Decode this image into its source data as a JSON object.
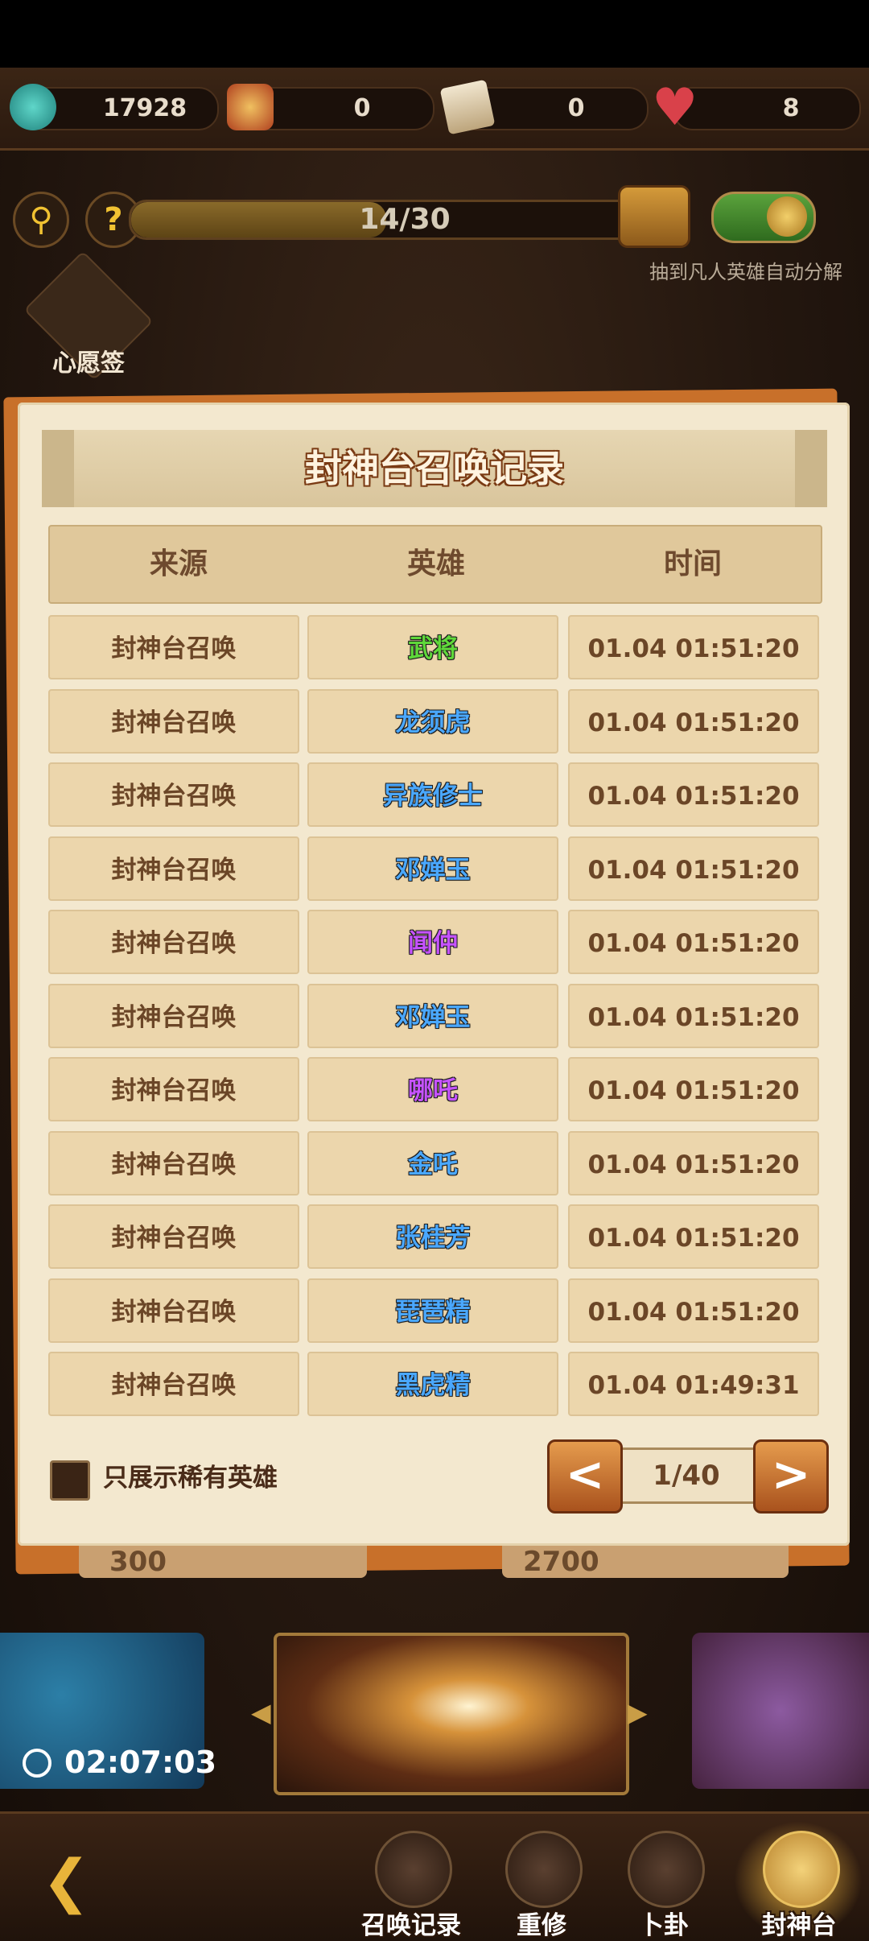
{
  "resources": {
    "jade": "17928",
    "red_envelope": "0",
    "card": "0",
    "hearts": "8"
  },
  "progress": {
    "label": "14/30",
    "current": 14,
    "total": 30
  },
  "auto_decompose_label": "抽到凡人英雄自动分解",
  "auto_decompose_on": true,
  "wish_label": "心愿签",
  "dialog": {
    "title": "封神台召唤记录",
    "headers": [
      "来源",
      "英雄",
      "时间"
    ],
    "rows": [
      {
        "source": "封神台召唤",
        "hero": "武将",
        "time": "01.04 01:51:20",
        "color": "#5fd83a"
      },
      {
        "source": "封神台召唤",
        "hero": "龙须虎",
        "time": "01.04 01:51:20",
        "color": "#4aa8ff"
      },
      {
        "source": "封神台召唤",
        "hero": "异族修士",
        "time": "01.04 01:51:20",
        "color": "#4aa8ff"
      },
      {
        "source": "封神台召唤",
        "hero": "邓婵玉",
        "time": "01.04 01:51:20",
        "color": "#4aa8ff"
      },
      {
        "source": "封神台召唤",
        "hero": "闻仲",
        "time": "01.04 01:51:20",
        "color": "#c653ff"
      },
      {
        "source": "封神台召唤",
        "hero": "邓婵玉",
        "time": "01.04 01:51:20",
        "color": "#4aa8ff"
      },
      {
        "source": "封神台召唤",
        "hero": "哪吒",
        "time": "01.04 01:51:20",
        "color": "#c653ff"
      },
      {
        "source": "封神台召唤",
        "hero": "金吒",
        "time": "01.04 01:51:20",
        "color": "#4aa8ff"
      },
      {
        "source": "封神台召唤",
        "hero": "张桂芳",
        "time": "01.04 01:51:20",
        "color": "#4aa8ff"
      },
      {
        "source": "封神台召唤",
        "hero": "琵琶精",
        "time": "01.04 01:51:20",
        "color": "#4aa8ff"
      },
      {
        "source": "封神台召唤",
        "hero": "黑虎精",
        "time": "01.04 01:49:31",
        "color": "#4aa8ff"
      }
    ],
    "rare_only_label": "只展示稀有英雄",
    "rare_only_checked": false,
    "pager": {
      "label": "1/40",
      "prev": "<",
      "next": ">"
    }
  },
  "peek_left": "300",
  "peek_right": "2700",
  "timer": "02:07:03",
  "back_symbol": "❮",
  "nav": [
    {
      "label": "召唤记录",
      "icon": "scroll-icon"
    },
    {
      "label": "重修",
      "icon": "figure-icon"
    },
    {
      "label": "卜卦",
      "icon": "bagua-icon"
    },
    {
      "label": "封神台",
      "icon": "altar-scroll-icon"
    }
  ],
  "colors": {
    "accent_gold": "#e8b43a",
    "dialog_bg": "#f3e8cf",
    "hero_green": "#5fd83a",
    "hero_blue": "#4aa8ff",
    "hero_purple": "#c653ff"
  }
}
